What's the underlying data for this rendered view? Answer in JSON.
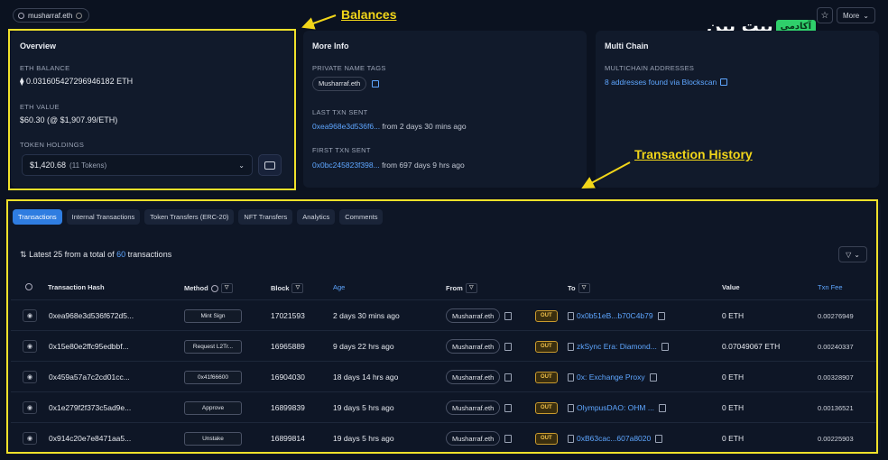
{
  "header": {
    "ens_name": "musharraf.eth",
    "more_label": "More",
    "star_icon": "star-icon"
  },
  "logo": {
    "text": "بیت پین",
    "badge": "آکادمی"
  },
  "annotations": {
    "balances": "Balances",
    "history": "Transaction History",
    "color": "#f2d619"
  },
  "overview": {
    "title": "Overview",
    "eth_balance_label": "ETH BALANCE",
    "eth_balance": "0.031605427296946182 ETH",
    "eth_value_label": "ETH VALUE",
    "eth_value": "$60.30 (@ $1,907.99/ETH)",
    "token_holdings_label": "TOKEN HOLDINGS",
    "token_value": "$1,420.68",
    "token_count": "(11 Tokens)"
  },
  "more_info": {
    "title": "More Info",
    "name_tags_label": "PRIVATE NAME TAGS",
    "name_tag": "Musharraf.eth",
    "last_txn_label": "LAST TXN SENT",
    "last_txn_hash": "0xea968e3d536f6...",
    "last_txn_time": "from 2 days 30 mins ago",
    "first_txn_label": "FIRST TXN SENT",
    "first_txn_hash": "0x0bc245823f398...",
    "first_txn_time": "from 697 days 9 hrs ago"
  },
  "multi_chain": {
    "title": "Multi Chain",
    "addresses_label": "MULTICHAIN ADDRESSES",
    "addresses_link": "8 addresses found via Blockscan"
  },
  "tabs": [
    {
      "label": "Transactions",
      "active": true
    },
    {
      "label": "Internal Transactions",
      "active": false
    },
    {
      "label": "Token Transfers (ERC-20)",
      "active": false
    },
    {
      "label": "NFT Transfers",
      "active": false
    },
    {
      "label": "Analytics",
      "active": false
    },
    {
      "label": "Comments",
      "active": false
    }
  ],
  "summary": {
    "prefix": "Latest 25 from a total of",
    "count": "60",
    "suffix": "transactions"
  },
  "columns": {
    "hash": "Transaction Hash",
    "method": "Method",
    "block": "Block",
    "age": "Age",
    "from": "From",
    "to": "To",
    "value": "Value",
    "fee": "Txn Fee"
  },
  "rows": [
    {
      "hash": "0xea968e3d536f672d5...",
      "method": "Mint Sign",
      "block": "17021593",
      "age": "2 days 30 mins ago",
      "from": "Musharraf.eth",
      "direction": "OUT",
      "to": "0x0b51eB...b70C4b79",
      "value": "0 ETH",
      "fee": "0.00276949"
    },
    {
      "hash": "0x15e80e2ffc95edbbf...",
      "method": "Request L2Tr...",
      "block": "16965889",
      "age": "9 days 22 hrs ago",
      "from": "Musharraf.eth",
      "direction": "OUT",
      "to": "zkSync Era: Diamond...",
      "value": "0.07049067 ETH",
      "fee": "0.00240337"
    },
    {
      "hash": "0x459a57a7c2cd01cc...",
      "method": "0x41f66600",
      "block": "16904030",
      "age": "18 days 14 hrs ago",
      "from": "Musharraf.eth",
      "direction": "OUT",
      "to": "0x: Exchange Proxy",
      "value": "0 ETH",
      "fee": "0.00328907"
    },
    {
      "hash": "0x1e279f2f373c5ad9e...",
      "method": "Approve",
      "block": "16899839",
      "age": "19 days 5 hrs ago",
      "from": "Musharraf.eth",
      "direction": "OUT",
      "to": "OlympusDAO: OHM ...",
      "value": "0 ETH",
      "fee": "0.00136521"
    },
    {
      "hash": "0x914c20e7e8471aa5...",
      "method": "Unstake",
      "block": "16899814",
      "age": "19 days 5 hrs ago",
      "from": "Musharraf.eth",
      "direction": "OUT",
      "to": "0xB63cac...607a8020",
      "value": "0 ETH",
      "fee": "0.00225903"
    }
  ]
}
